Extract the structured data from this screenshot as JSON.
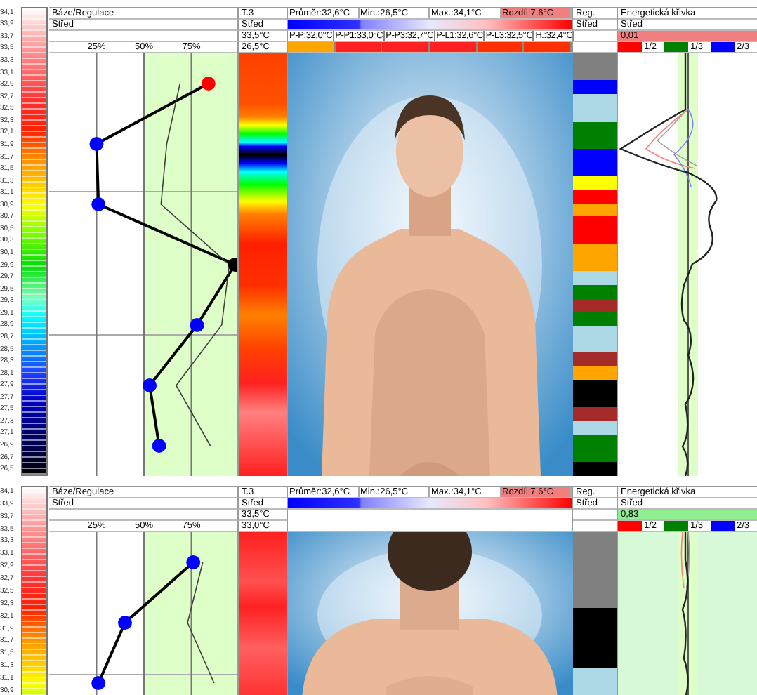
{
  "panels": [
    {
      "scale_labels": [
        "34,1",
        "33,9",
        "33,7",
        "33,5",
        "33,3",
        "33,1",
        "32,9",
        "32,7",
        "32,5",
        "32,3",
        "32,1",
        "31,9",
        "31,7",
        "31,5",
        "31,3",
        "31,1",
        "30,9",
        "30,7",
        "30,5",
        "30,3",
        "30,1",
        "29,9",
        "29,7",
        "29,5",
        "29,3",
        "29,1",
        "28,9",
        "28,7",
        "28,5",
        "28,3",
        "28,1",
        "27,9",
        "27,7",
        "27,5",
        "27,3",
        "27,1",
        "26,9",
        "26,7",
        "26,5"
      ],
      "base": {
        "title": "Báze/Regulace",
        "mode": "Střed",
        "markers": [
          {
            "color": "#ff0000"
          },
          {
            "color": "#0000ff"
          },
          {
            "color": "#0000ff"
          },
          {
            "color": "#000000"
          },
          {
            "color": "#0000ff"
          },
          {
            "color": "#0000ff"
          },
          {
            "color": "#0000ff"
          }
        ]
      },
      "chart_data": {
        "type": "line",
        "orientation": "horizontal",
        "xlim": [
          0,
          100
        ],
        "grid": true,
        "xticks": [
          {
            "value": 25,
            "label": "25%"
          },
          {
            "value": 50,
            "label": "50%"
          },
          {
            "value": 75,
            "label": "75%"
          }
        ],
        "series": [
          {
            "color": "#000000",
            "marker": "circle",
            "values": [
              84,
              25,
              26,
              98,
              78,
              53,
              58
            ]
          },
          {
            "color": "#404040",
            "values": [
              69,
              62,
              59,
              95,
              91,
              67,
              85
            ]
          }
        ]
      },
      "t3": {
        "title": "T.3",
        "mode": "Střed",
        "max": "33,5°C",
        "min": "26,5°C"
      },
      "stats": [
        {
          "label": "Průměr:32,6°C",
          "highlight": false
        },
        {
          "label": "Min.:26,5°C",
          "highlight": false
        },
        {
          "label": "Max.:34,1°C",
          "highlight": false
        },
        {
          "label": "Rozdíl:7,6°C",
          "highlight": true
        }
      ],
      "zones": [
        {
          "label": "P-P:32,0°C",
          "color": "#ffa500"
        },
        {
          "label": "P-P1:33,0°C",
          "color": "#ff2020"
        },
        {
          "label": "P-P3:32,7°C",
          "color": "#ff2020"
        },
        {
          "label": "P-L1:32,6°C",
          "color": "#ff2020"
        },
        {
          "label": "P-L3:32,5°C",
          "color": "#ff3000"
        },
        {
          "label": "H.:32,4°C",
          "color": "#ff3000"
        }
      ],
      "picture": {
        "kind": "picture"
      },
      "reg": {
        "title": "Reg.",
        "mode": "Střed",
        "bands": [
          {
            "color": "#808080"
          },
          {
            "color": "#808080"
          },
          {
            "color": "#0000ff"
          },
          {
            "color": "#add8e6"
          },
          {
            "color": "#add8e6"
          },
          {
            "color": "#008000"
          },
          {
            "color": "#008000"
          },
          {
            "color": "#0000ff"
          },
          {
            "color": "#0000ff"
          },
          {
            "color": "#ffff00"
          },
          {
            "color": "#ff0000"
          },
          {
            "color": "#ffa500"
          },
          {
            "color": "#ff0000"
          },
          {
            "color": "#ff0000"
          },
          {
            "color": "#ffa500"
          },
          {
            "color": "#ffa500"
          },
          {
            "color": "#add8e6"
          },
          {
            "color": "#008000"
          },
          {
            "color": "#a52a2a"
          },
          {
            "color": "#008000"
          },
          {
            "color": "#add8e6"
          },
          {
            "color": "#add8e6"
          },
          {
            "color": "#a52a2a"
          },
          {
            "color": "#ffa500"
          },
          {
            "color": "#000000"
          },
          {
            "color": "#000000"
          },
          {
            "color": "#a52a2a"
          },
          {
            "color": "#add8e6"
          },
          {
            "color": "#008000"
          },
          {
            "color": "#008000"
          },
          {
            "color": "#000000"
          }
        ]
      },
      "energy": {
        "title": "Energetická křivka",
        "mode": "Střed",
        "value": "0,01",
        "color": "#f08080",
        "legend": [
          {
            "label": "1/2",
            "color": "#ff0000"
          },
          {
            "label": "1/3",
            "color": "#008000"
          },
          {
            "label": "2/3",
            "color": "#0000ff"
          }
        ]
      }
    },
    {
      "scale_labels": [
        "34,1",
        "33,9",
        "33,7",
        "33,5",
        "33,3",
        "33,1",
        "32,9",
        "32,7",
        "32,5",
        "32,3",
        "32,1",
        "31,9",
        "31,7",
        "31,5",
        "31,3",
        "31,1",
        "30,9"
      ],
      "base": {
        "title": "Báze/Regulace",
        "mode": "Střed",
        "markers": [
          {
            "color": "#0000ff"
          },
          {
            "color": "#0000ff"
          },
          {
            "color": "#0000ff"
          }
        ]
      },
      "chart_data": {
        "type": "line",
        "orientation": "horizontal",
        "xlim": [
          0,
          100
        ],
        "grid": true,
        "xticks": [
          {
            "value": 25,
            "label": "25%"
          },
          {
            "value": 50,
            "label": "50%"
          },
          {
            "value": 75,
            "label": "75%"
          }
        ],
        "series": [
          {
            "color": "#000000",
            "marker": "circle",
            "values": [
              76,
              40,
              26
            ]
          },
          {
            "color": "#404040",
            "values": [
              81,
              73,
              87
            ]
          }
        ]
      },
      "t3": {
        "title": "T.3",
        "mode": "Střed",
        "max": "33,5°C",
        "min": "33,0°C"
      },
      "stats": [
        {
          "label": "Průměr:32,6°C",
          "highlight": false
        },
        {
          "label": "Min.:26,5°C",
          "highlight": false
        },
        {
          "label": "Max.:34,1°C",
          "highlight": false
        },
        {
          "label": "Rozdíl:7,6°C",
          "highlight": true
        }
      ],
      "picture": {
        "kind": "picture"
      },
      "reg": {
        "title": "Reg.",
        "mode": "Střed",
        "bands": [
          {
            "color": "#808080"
          },
          {
            "color": "#808080"
          },
          {
            "color": "#808080"
          },
          {
            "color": "#808080"
          },
          {
            "color": "#808080"
          },
          {
            "color": "#000000"
          },
          {
            "color": "#000000"
          },
          {
            "color": "#000000"
          },
          {
            "color": "#000000"
          },
          {
            "color": "#add8e6"
          },
          {
            "color": "#add8e6"
          }
        ]
      },
      "energy": {
        "title": "Energetická křivka",
        "mode": "Střed",
        "value": "0,83",
        "color": "#90ee90",
        "legend": [
          {
            "label": "1/2",
            "color": "#ff0000"
          },
          {
            "label": "1/3",
            "color": "#008000"
          },
          {
            "label": "2/3",
            "color": "#0000ff"
          }
        ]
      }
    }
  ]
}
